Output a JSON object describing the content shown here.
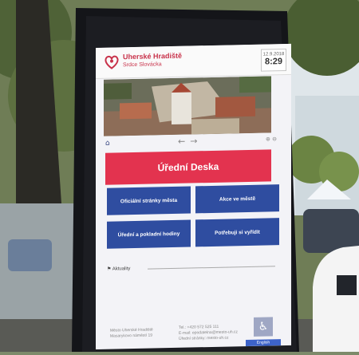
{
  "scene": {
    "description_colors": {
      "panel": "#111217",
      "screen_bg": "#f3f3f7",
      "accent_red": "#e3334f",
      "tile_blue": "#2f4da0"
    }
  },
  "kiosk": {
    "header": {
      "brand": "Uherské Hradiště",
      "brand_sub": "Srdce Slovácka",
      "date": "12.9.2018",
      "time": "8:29"
    },
    "nav": {
      "home_icon": "home-icon",
      "prev_icon": "arrow-left-icon",
      "next_icon": "arrow-right-icon",
      "zoom_icon": "zoom-icon"
    },
    "main_button": "Úřední Deska",
    "tiles": [
      "Oficiální stránky města",
      "Akce ve městě",
      "Úřední a pokladní hodiny",
      "Potřebuji si vyřídit"
    ],
    "news_label": "Aktuality",
    "footer": {
      "left_line1": "Město Uherské Hradiště",
      "left_line2": "Masarykovo náměstí 19",
      "right_line1": "Tel.: +420 572 525 111",
      "right_line2": "E-mail: epodatelna@mesto-uh.cz",
      "right_line3": "Úřední stránky: mesto-uh.cz",
      "lang_btn": "English",
      "accessibility_icon": "wheelchair-icon"
    }
  }
}
